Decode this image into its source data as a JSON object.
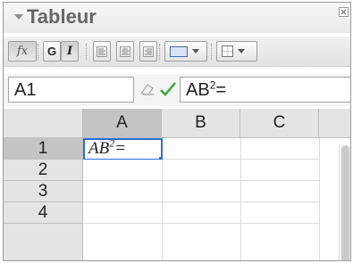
{
  "window": {
    "title": "Tableur",
    "collapse_icon": "triangle-down-icon",
    "close_icon": "close-icon"
  },
  "toolbar": {
    "fx_label": "fx",
    "bold_label": "G",
    "italic_label": "I",
    "align_icons": [
      "align-left-icon",
      "align-center-icon",
      "align-right-icon"
    ],
    "bg_color_icon": "background-color-icon",
    "border_icon": "border-icon",
    "accent": "#2e6bd9"
  },
  "input_bar": {
    "cell_reference": "A1",
    "formula_base": "AB",
    "formula_sup": "2",
    "formula_suffix": "=",
    "eraser_icon": "eraser-icon",
    "confirm_icon": "check-icon",
    "confirm_color": "#3aa83a"
  },
  "grid": {
    "columns": [
      "A",
      "B",
      "C"
    ],
    "rows": [
      "1",
      "2",
      "3",
      "4"
    ],
    "selected_column": "A",
    "selected_row": "1",
    "active_cell": {
      "ref": "A1",
      "base": "AB",
      "sup": "2",
      "suffix": "="
    }
  }
}
